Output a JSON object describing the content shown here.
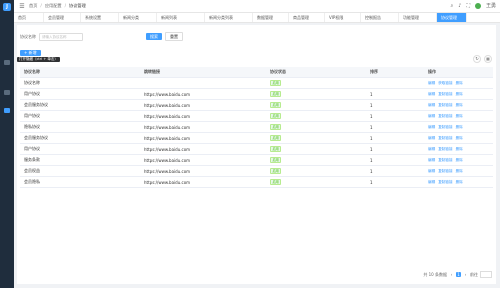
{
  "sidebar": {
    "logo": "J"
  },
  "topbar": {
    "breadcrumb": [
      "首页",
      "应用配置",
      "协议管理"
    ],
    "user": "王勇"
  },
  "tabs": [
    {
      "label": "首页"
    },
    {
      "label": "会员管理"
    },
    {
      "label": "系统设置"
    },
    {
      "label": "新闻分类"
    },
    {
      "label": "新闻列表"
    },
    {
      "label": "新闻分类列表"
    },
    {
      "label": "数据管理"
    },
    {
      "label": "商品管理"
    },
    {
      "label": "VIP权限"
    },
    {
      "label": "控制报告"
    },
    {
      "label": "功能管理"
    },
    {
      "label": "协议管理"
    }
  ],
  "search": {
    "label": "协议名称",
    "placeholder": "请输入协议名称",
    "search_btn": "搜索",
    "reset_btn": "重置"
  },
  "add_btn": "+ 新增",
  "tooltip": "打开隐藏（ctrl + 单击）",
  "table": {
    "headers": [
      "协议名称",
      "跳转链接",
      "协议状态",
      "排序",
      "操作"
    ],
    "rows": [
      {
        "name": "协议名称",
        "link": "",
        "status": "启用",
        "sort": "",
        "actions": [
          "编辑",
          "获取链接",
          "删除"
        ]
      },
      {
        "name": "用户协议",
        "link": "https://www.baidu.com",
        "status": "启用",
        "sort": "1",
        "actions": [
          "编辑",
          "复制链接",
          "删除"
        ]
      },
      {
        "name": "会员服务协议",
        "link": "https://www.baidu.com",
        "status": "启用",
        "sort": "1",
        "actions": [
          "编辑",
          "复制链接",
          "删除"
        ]
      },
      {
        "name": "用户协议",
        "link": "https://www.baidu.com",
        "status": "启用",
        "sort": "1",
        "actions": [
          "编辑",
          "复制链接",
          "删除"
        ]
      },
      {
        "name": "隐私协议",
        "link": "https://www.baidu.com",
        "status": "启用",
        "sort": "1",
        "actions": [
          "编辑",
          "复制链接",
          "删除"
        ]
      },
      {
        "name": "会员服务协议",
        "link": "https://www.baidu.com",
        "status": "启用",
        "sort": "1",
        "actions": [
          "编辑",
          "复制链接",
          "删除"
        ]
      },
      {
        "name": "用户协议",
        "link": "https://www.baidu.com",
        "status": "启用",
        "sort": "1",
        "actions": [
          "编辑",
          "复制链接",
          "删除"
        ]
      },
      {
        "name": "服务条款",
        "link": "https://www.baidu.com",
        "status": "启用",
        "sort": "1",
        "actions": [
          "编辑",
          "复制链接",
          "删除"
        ]
      },
      {
        "name": "会员权益",
        "link": "https://www.baidu.com",
        "status": "启用",
        "sort": "1",
        "actions": [
          "编辑",
          "复制链接",
          "删除"
        ]
      },
      {
        "name": "会员隐私",
        "link": "https://www.baidu.com",
        "status": "启用",
        "sort": "1",
        "actions": [
          "编辑",
          "复制链接",
          "删除"
        ]
      }
    ]
  },
  "pagination": {
    "total": "共 10 条数据",
    "page": "1",
    "goto": "前往"
  }
}
